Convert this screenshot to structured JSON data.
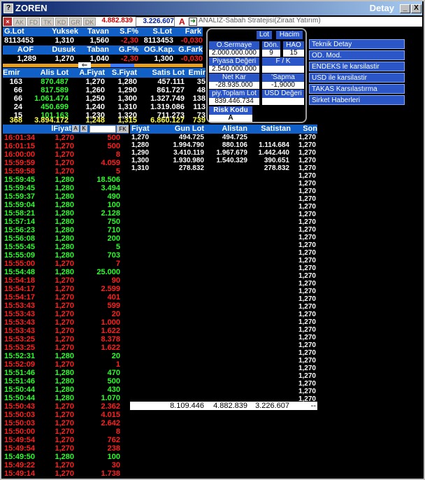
{
  "window": {
    "title": "ZOREN",
    "detail_label": "Detay",
    "min": "_",
    "close": "X"
  },
  "toolbar": {
    "buttons": [
      "AK",
      "FD",
      "TK",
      "KD",
      "GR",
      "DK"
    ],
    "value1": "4.882.839",
    "value2": "3.226.607",
    "a_label": "A",
    "analysis_text": "ANALIZ-Sabah Stratejisi(Ziraat Yatırım)"
  },
  "summary": {
    "h1": [
      "G.Lot",
      "Yuksek",
      "Tavan",
      "S.F%",
      "S.Lot",
      "Fark"
    ],
    "v1": [
      "8113453",
      "1,310",
      "1,560",
      "-2,30",
      "8113453",
      "-0,030"
    ],
    "h2": [
      "AOF",
      "Dusuk",
      "Taban",
      "G.F%",
      "OG.Kap.",
      "G.Fark"
    ],
    "v2": [
      "1,289",
      "1,270",
      "1,040",
      "-2,30",
      "1,300",
      "-0,030"
    ]
  },
  "depth": {
    "headers": [
      "Emir",
      "Alis Lot",
      "A.Fiyat",
      "S.Fiyat",
      "Satis Lot",
      "Emir"
    ],
    "rows": [
      [
        "163",
        "870.487",
        "1,270",
        "1,280",
        "457.111",
        "35"
      ],
      [
        "66",
        "817.589",
        "1,260",
        "1,290",
        "861.727",
        "48"
      ],
      [
        "66",
        "1.061.474",
        "1,250",
        "1,300",
        "1.327.749",
        "138"
      ],
      [
        "24",
        "450.699",
        "1,240",
        "1,310",
        "1.319.086",
        "113"
      ],
      [
        "15",
        "101.163",
        "1,230",
        "1,320",
        "711.273",
        "73"
      ]
    ],
    "total": [
      "368",
      "3.894.172",
      "1,248",
      "1,315",
      "6.860.127",
      "739"
    ]
  },
  "popup": {
    "lot": "Lot",
    "hacim": "Hacim",
    "osermaye": "O.Sermaye",
    "osermaye_val": "2.000.000.000",
    "don": "Dön.",
    "don_val": "9",
    "hao": "HAO",
    "hao_val": "15",
    "piyasa": "Piyasa Değeri",
    "piyasa_val": "2.540.000.000",
    "fk": "F / K",
    "fk_val": "",
    "netkar": "Net Kar",
    "netkar_val": "-28.935.000",
    "sapma": "'Sapma",
    "sapma_val": "-1,9000",
    "piytoplam": "piy.Toplam Lot",
    "piytoplam_val": "839.446.734",
    "usd": "USD Değeri",
    "usd_val": "",
    "risk": "Risk Kodu",
    "risk_val": "A"
  },
  "side_buttons": [
    "Teknik Detay",
    "OD. Mod.",
    "ENDEKS le karsilastir",
    "USD ile karsilastir",
    "TAKAS Karsılastırma",
    "Sirket Haberleri"
  ],
  "trades": {
    "header": "lFiyat",
    "a_btn": "A",
    "k_btn": "K",
    "fk_btn": "FK",
    "rows": [
      [
        "16:01:34",
        "1,270",
        "500",
        "r"
      ],
      [
        "16:01:15",
        "1,270",
        "500",
        "r"
      ],
      [
        "16:00:00",
        "1,270",
        "8",
        "r"
      ],
      [
        "15:59:59",
        "1,270",
        "4.059",
        "r"
      ],
      [
        "15:59:58",
        "1,270",
        "5",
        "r"
      ],
      [
        "15:59:45",
        "1,280",
        "18.506",
        "g"
      ],
      [
        "15:59:45",
        "1,280",
        "3.494",
        "g"
      ],
      [
        "15:59:37",
        "1,280",
        "490",
        "g"
      ],
      [
        "15:59:04",
        "1,280",
        "100",
        "g"
      ],
      [
        "15:58:21",
        "1,280",
        "2.128",
        "g"
      ],
      [
        "15:57:14",
        "1,280",
        "750",
        "g"
      ],
      [
        "15:56:23",
        "1,280",
        "710",
        "g"
      ],
      [
        "15:56:08",
        "1,280",
        "200",
        "g"
      ],
      [
        "15:55:45",
        "1,280",
        "5",
        "g"
      ],
      [
        "15:55:09",
        "1,280",
        "703",
        "g"
      ],
      [
        "15:55:00",
        "1,270",
        "7",
        "r"
      ],
      [
        "15:54:48",
        "1,280",
        "25.000",
        "g"
      ],
      [
        "15:54:18",
        "1,270",
        "90",
        "r"
      ],
      [
        "15:54:17",
        "1,270",
        "2.599",
        "r"
      ],
      [
        "15:54:17",
        "1,270",
        "401",
        "r"
      ],
      [
        "15:53:43",
        "1,270",
        "599",
        "r"
      ],
      [
        "15:53:43",
        "1,270",
        "20",
        "r"
      ],
      [
        "15:53:43",
        "1,270",
        "1.000",
        "r"
      ],
      [
        "15:53:43",
        "1,270",
        "1.622",
        "r"
      ],
      [
        "15:53:25",
        "1,270",
        "8.378",
        "r"
      ],
      [
        "15:53:25",
        "1,270",
        "1.622",
        "r"
      ],
      [
        "15:52:31",
        "1,280",
        "20",
        "g"
      ],
      [
        "15:52:09",
        "1,270",
        "1",
        "r"
      ],
      [
        "15:51:46",
        "1,280",
        "470",
        "g"
      ],
      [
        "15:51:46",
        "1,280",
        "500",
        "g"
      ],
      [
        "15:50:44",
        "1,280",
        "430",
        "g"
      ],
      [
        "15:50:44",
        "1,280",
        "1.070",
        "g"
      ],
      [
        "15:50:43",
        "1,270",
        "2.362",
        "r"
      ],
      [
        "15:50:03",
        "1,270",
        "4.015",
        "r"
      ],
      [
        "15:50:03",
        "1,270",
        "2.642",
        "r"
      ],
      [
        "15:50:00",
        "1,270",
        "8",
        "r"
      ],
      [
        "15:49:54",
        "1,270",
        "762",
        "r"
      ],
      [
        "15:49:54",
        "1,270",
        "238",
        "r"
      ],
      [
        "15:49:50",
        "1,280",
        "100",
        "g"
      ],
      [
        "15:49:22",
        "1,270",
        "30",
        "r"
      ],
      [
        "15:49:14",
        "1,270",
        "1.738",
        "r"
      ]
    ]
  },
  "price_table": {
    "headers": [
      "Fiyat",
      "Gun Lot",
      "Alistan",
      "Satistan",
      "Son"
    ],
    "rows": [
      [
        "1,270",
        "494.725",
        "494.725",
        "",
        "1,270"
      ],
      [
        "1,280",
        "1.994.790",
        "880.106",
        "1.114.684",
        "1,270"
      ],
      [
        "1,290",
        "3.410.119",
        "1.967.679",
        "1.442.440",
        "1,270"
      ],
      [
        "1,300",
        "1.930.980",
        "1.540.329",
        "390.651",
        "1,270"
      ],
      [
        "1,310",
        "278.832",
        "",
        "278.832",
        "1,270"
      ]
    ],
    "son_extra": [
      "1,270",
      "1,270",
      "1,270",
      "1,270",
      "1,270",
      "1,270",
      "1,270",
      "1,270",
      "1,270",
      "1,270",
      "1,270",
      "1,270",
      "1,270",
      "1,270",
      "1,270",
      "1,270",
      "1,270",
      "1,270",
      "1,270",
      "1,270",
      "1,270",
      "1,270",
      "1,270",
      "1,270",
      "1,270",
      "1,270",
      "1,270",
      "1,270",
      "1,270",
      "1,270"
    ],
    "total": [
      "8.109.446",
      "4.882.839",
      "3.226.607",
      "--"
    ]
  }
}
